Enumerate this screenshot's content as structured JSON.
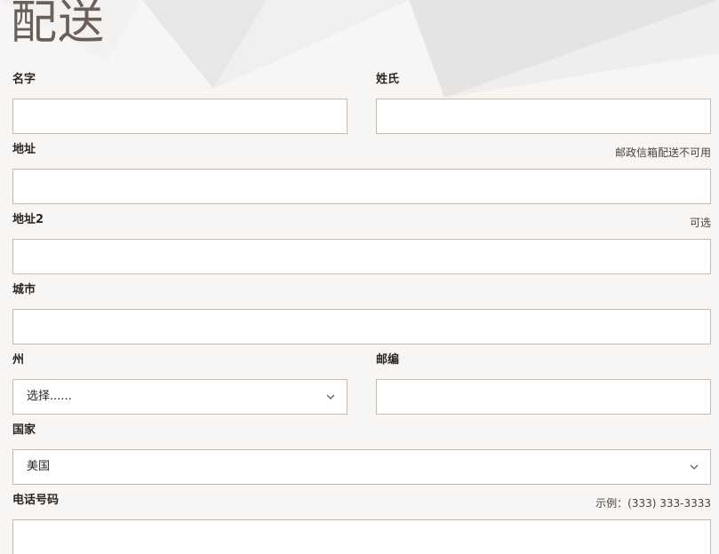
{
  "form": {
    "title": "配送",
    "fields": {
      "first_name": {
        "label": "名字",
        "value": ""
      },
      "last_name": {
        "label": "姓氏",
        "value": ""
      },
      "address": {
        "label": "地址",
        "hint": "邮政信箱配送不可用",
        "value": ""
      },
      "address2": {
        "label": "地址2",
        "hint": "可选",
        "value": ""
      },
      "city": {
        "label": "城市",
        "value": ""
      },
      "state": {
        "label": "州",
        "selected": "选择......"
      },
      "zip": {
        "label": "邮编",
        "value": ""
      },
      "country": {
        "label": "国家",
        "selected": "美国"
      },
      "phone": {
        "label": "电话号码",
        "hint": "示例：(333) 333-3333",
        "value": ""
      }
    }
  },
  "colors": {
    "title": "#6b5f58",
    "border": "#c8b9a8",
    "label": "#2b2623"
  },
  "icons": {
    "select_arrow": "chevron-down-icon"
  }
}
